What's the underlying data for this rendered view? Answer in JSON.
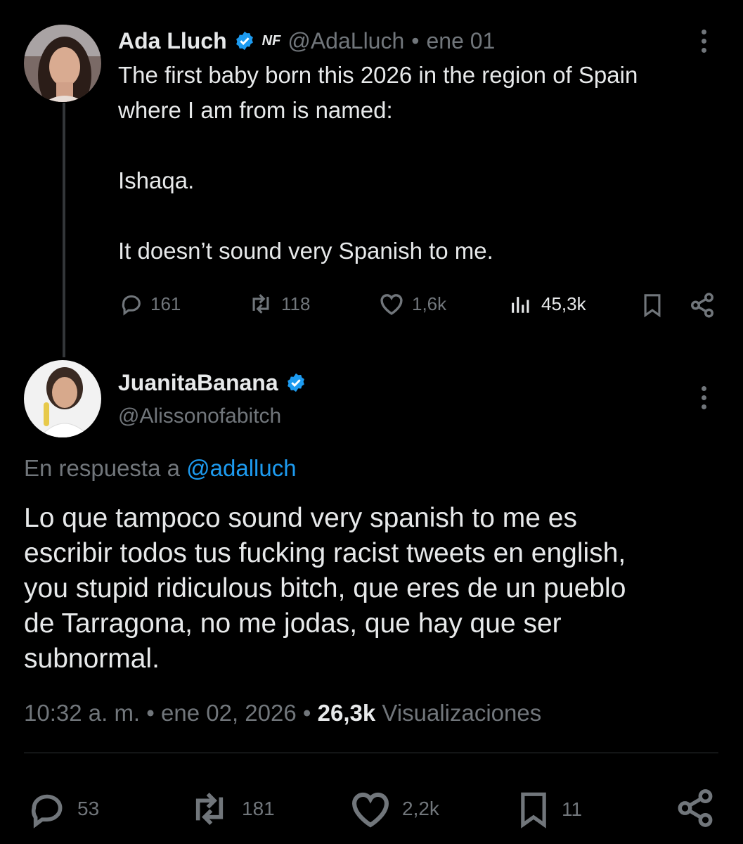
{
  "tweet1": {
    "name": "Ada Lluch",
    "handle": "@AdaLluch",
    "separator": "•",
    "date": "ene 01",
    "badge": "NF",
    "text": "The first baby born this 2026 in the region of Spain\nwhere I am from is named:\n\nIshaqa.\n\nIt doesn’t sound very Spanish to me.",
    "replies": "161",
    "retweets": "118",
    "likes": "1,6k",
    "views": "45,3k"
  },
  "tweet2": {
    "name": "JuanitaBanana",
    "handle": "@Alissonofabitch",
    "reply_prefix": "En respuesta a",
    "reply_to": "@adalluch",
    "text": "Lo que tampoco sound very spanish to me es\nescribir todos tus fucking racist tweets en english,\nyou stupid ridiculous bitch, que eres de un pueblo\nde Tarragona, no me jodas, que hay que ser\nsubnormal.",
    "time": "10:32 a. m.",
    "sep1": "•",
    "date": "ene 02, 2026",
    "sep2": "•",
    "views_count": "26,3k",
    "views_label": "Visualizaciones",
    "replies": "53",
    "retweets": "181",
    "likes": "2,2k",
    "bookmarks": "11"
  },
  "colors": {
    "background": "#000000",
    "text": "#e7e9ea",
    "muted": "#71767b",
    "link": "#1d9bf0",
    "verified": "#1d9bf0"
  }
}
